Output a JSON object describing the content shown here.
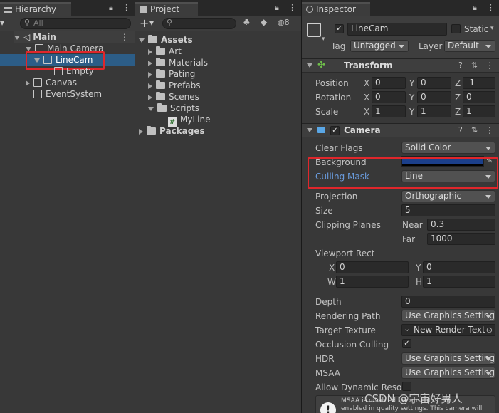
{
  "hierarchy": {
    "tab_title": "Hierarchy",
    "search_placeholder": "All",
    "scene": "Main",
    "items": {
      "main_camera": "Main Camera",
      "linecam": "LineCam",
      "empty": "Empty",
      "canvas": "Canvas",
      "eventsystem": "EventSystem"
    }
  },
  "project": {
    "tab_title": "Project",
    "add_label": "+",
    "hidden_count": "8",
    "assets": "Assets",
    "folders": [
      "Art",
      "Materials",
      "Pating",
      "Prefabs",
      "Scenes",
      "Scripts"
    ],
    "script_file": "MyLine",
    "packages": "Packages"
  },
  "inspector": {
    "tab_title": "Inspector",
    "object_name": "LineCam",
    "static_label": "Static",
    "tag_label": "Tag",
    "tag_value": "Untagged",
    "layer_label": "Layer",
    "layer_value": "Default",
    "transform": {
      "title": "Transform",
      "position_label": "Position",
      "rotation_label": "Rotation",
      "scale_label": "Scale",
      "position": {
        "x": "0",
        "y": "0",
        "z": "-1"
      },
      "rotation": {
        "x": "0",
        "y": "0",
        "z": "0"
      },
      "scale": {
        "x": "1",
        "y": "1",
        "z": "1"
      }
    },
    "camera": {
      "title": "Camera",
      "clear_flags_label": "Clear Flags",
      "clear_flags_value": "Solid Color",
      "background_label": "Background",
      "background_color": "#1b3f8a",
      "culling_mask_label": "Culling Mask",
      "culling_mask_value": "Line",
      "projection_label": "Projection",
      "projection_value": "Orthographic",
      "size_label": "Size",
      "size_value": "5",
      "clipping_planes_label": "Clipping Planes",
      "near_label": "Near",
      "near_value": "0.3",
      "far_label": "Far",
      "far_value": "1000",
      "viewport_label": "Viewport Rect",
      "viewport": {
        "x": "0",
        "y": "0",
        "w": "1",
        "h": "1"
      },
      "depth_label": "Depth",
      "depth_value": "0",
      "rendering_path_label": "Rendering Path",
      "rendering_path_value": "Use Graphics Settings",
      "target_texture_label": "Target Texture",
      "target_texture_value": "New Render Text",
      "occlusion_label": "Occlusion Culling",
      "hdr_label": "HDR",
      "hdr_value": "Use Graphics Settings",
      "msaa_label": "MSAA",
      "msaa_value": "Use Graphics Settings",
      "dynamic_res_label": "Allow Dynamic Resol",
      "warning_text_line1": "MSAA is disabled because it is not",
      "warning_text_line2": "enabled in quality settings. This camera will"
    }
  },
  "watermark": "CSDN @宇宙好男人",
  "colors": {
    "accent": "#2c5d87",
    "highlight_box": "#e0262b",
    "link_label": "#6a9cde"
  }
}
